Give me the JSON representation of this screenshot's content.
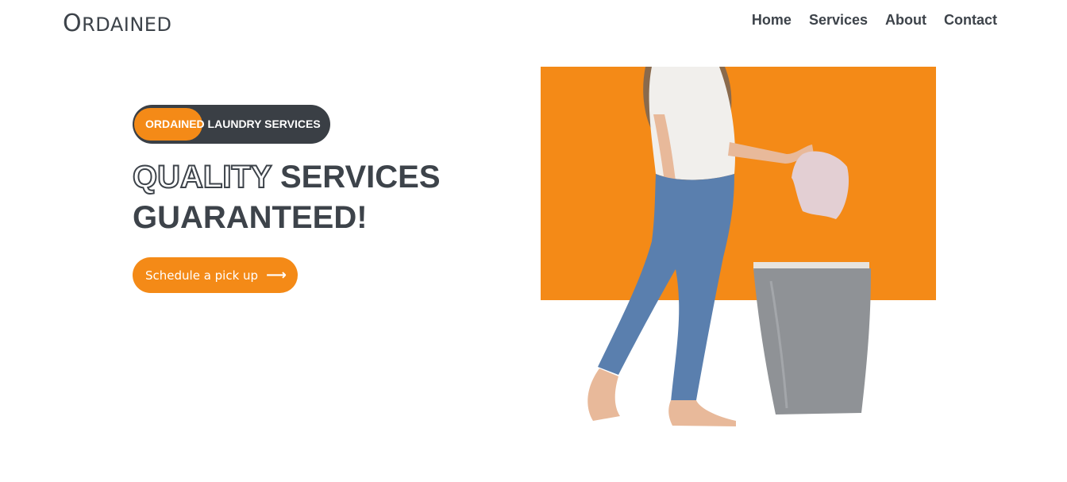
{
  "brand": {
    "first_letter": "O",
    "rest": "RDAINED"
  },
  "nav": {
    "home": "Home",
    "services": "Services",
    "about": "About",
    "contact": "Contact"
  },
  "hero": {
    "badge": "ORDAINED LAUNDRY SERVICES",
    "headline_outline": "QUALITY",
    "headline_rest": " SERVICES",
    "headline_line2": "GUARANTEED!",
    "cta_label": "Schedule a pick up",
    "cta_icon": "arrow-right-icon"
  },
  "colors": {
    "accent": "#f48a17",
    "dark": "#3d434a",
    "pill": "#3a3f45"
  }
}
